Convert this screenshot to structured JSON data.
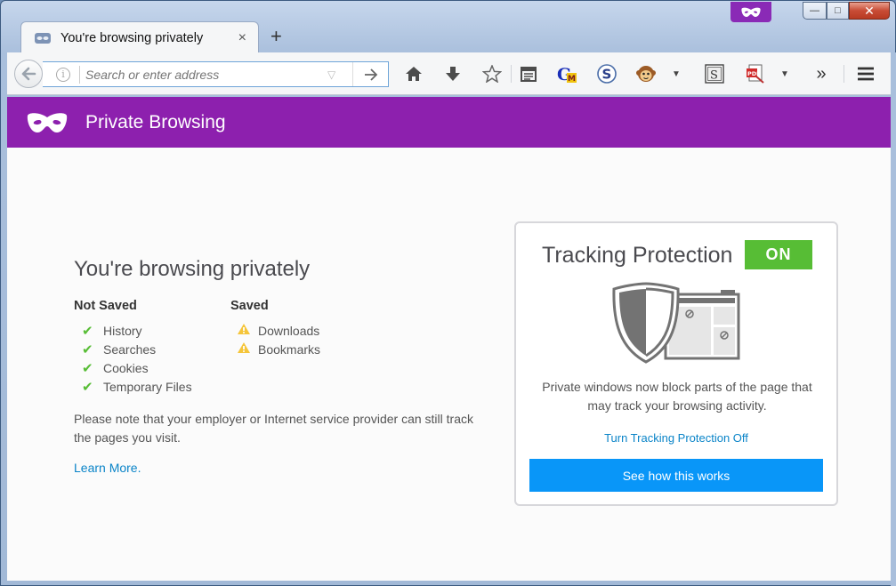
{
  "window": {
    "tab_title": "You're browsing privately",
    "tab_close": "×",
    "new_tab": "+",
    "min": "—",
    "max": "□",
    "close": "✕"
  },
  "navbar": {
    "url_placeholder": "Search or enter address",
    "overflow": "»",
    "toolbar_icons": [
      "home-icon",
      "download-icon",
      "bookmark-star-icon",
      "reading-list-icon",
      "gm-addon-icon",
      "s-addon-icon",
      "greasemonkey-icon",
      "s-square-addon-icon",
      "pdf-addon-icon",
      "menu-icon"
    ]
  },
  "header": {
    "title": "Private Browsing"
  },
  "main": {
    "heading": "You're browsing privately",
    "not_saved": {
      "title": "Not Saved",
      "items": [
        "History",
        "Searches",
        "Cookies",
        "Temporary Files"
      ]
    },
    "saved": {
      "title": "Saved",
      "items": [
        "Downloads",
        "Bookmarks"
      ]
    },
    "note": "Please note that your employer or Internet service provider can still track the pages you visit.",
    "learn_more": "Learn More."
  },
  "tracking": {
    "title": "Tracking Protection",
    "status": "ON",
    "description": "Private windows now block parts of the page that may track your browsing activity.",
    "turn_off": "Turn Tracking Protection Off",
    "button": "See how this works"
  },
  "colors": {
    "accent_purple": "#8d20ae",
    "on_green": "#57bd35",
    "button_blue": "#0996f8",
    "link_blue": "#0a84c8"
  }
}
